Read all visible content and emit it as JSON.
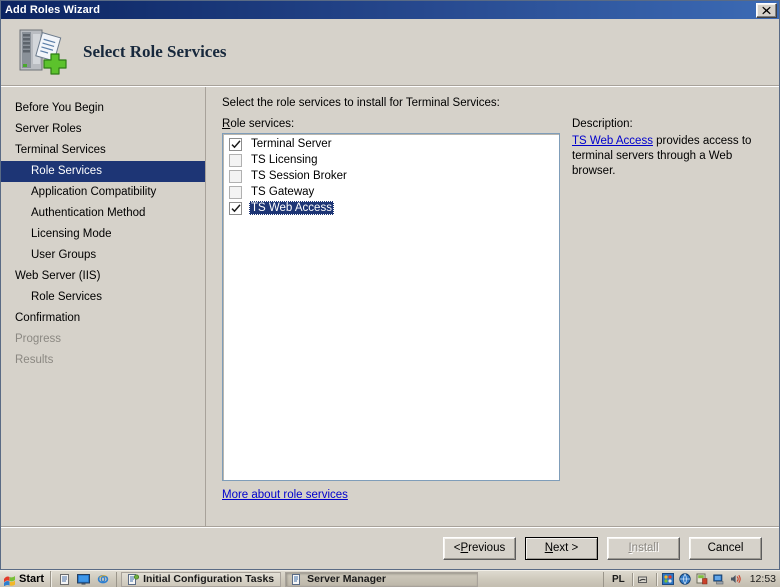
{
  "window": {
    "title": "Add Roles Wizard",
    "close_label": "✕"
  },
  "header": {
    "title": "Select Role Services",
    "icon": "server-add-icon"
  },
  "sidebar": {
    "items": [
      {
        "label": "Before You Begin",
        "indent": false,
        "state": "normal"
      },
      {
        "label": "Server Roles",
        "indent": false,
        "state": "normal"
      },
      {
        "label": "Terminal Services",
        "indent": false,
        "state": "normal"
      },
      {
        "label": "Role Services",
        "indent": true,
        "state": "selected"
      },
      {
        "label": "Application Compatibility",
        "indent": true,
        "state": "normal"
      },
      {
        "label": "Authentication Method",
        "indent": true,
        "state": "normal"
      },
      {
        "label": "Licensing Mode",
        "indent": true,
        "state": "normal"
      },
      {
        "label": "User Groups",
        "indent": true,
        "state": "normal"
      },
      {
        "label": "Web Server (IIS)",
        "indent": false,
        "state": "normal"
      },
      {
        "label": "Role Services",
        "indent": true,
        "state": "normal"
      },
      {
        "label": "Confirmation",
        "indent": false,
        "state": "normal"
      },
      {
        "label": "Progress",
        "indent": false,
        "state": "disabled"
      },
      {
        "label": "Results",
        "indent": false,
        "state": "disabled"
      }
    ]
  },
  "main": {
    "intro": "Select the role services to install for Terminal Services:",
    "list_label_accel": "R",
    "list_label_rest": "ole services:",
    "role_services": [
      {
        "label": "Terminal Server",
        "checked": true,
        "selected": false
      },
      {
        "label": "TS Licensing",
        "checked": false,
        "selected": false
      },
      {
        "label": "TS Session Broker",
        "checked": false,
        "selected": false
      },
      {
        "label": "TS Gateway",
        "checked": false,
        "selected": false
      },
      {
        "label": "TS Web Access",
        "checked": true,
        "selected": true
      }
    ],
    "more_link": "More about role services"
  },
  "description": {
    "title": "Description:",
    "link_text": "TS Web Access",
    "body_text": " provides access to terminal servers through a Web browser."
  },
  "footer": {
    "buttons": [
      {
        "name": "previous",
        "pre": "< ",
        "accel": "P",
        "post": "revious",
        "state": "normal"
      },
      {
        "name": "next",
        "pre": "",
        "accel": "N",
        "post": "ext >",
        "state": "default"
      },
      {
        "name": "install",
        "pre": "",
        "accel": "I",
        "post": "nstall",
        "state": "disabled"
      },
      {
        "name": "cancel",
        "pre": "Cancel",
        "accel": "",
        "post": "",
        "state": "normal"
      }
    ]
  },
  "taskbar": {
    "start_label": "Start",
    "tasks": [
      {
        "label": "Initial Configuration Tasks",
        "active": false
      },
      {
        "label": "Server Manager",
        "active": true
      }
    ],
    "language": "PL",
    "clock": "12:53"
  },
  "colors": {
    "title_bar": "#0b2461",
    "selection": "#1d3575",
    "window_face": "#d6d2ca",
    "link": "#0000cc"
  }
}
